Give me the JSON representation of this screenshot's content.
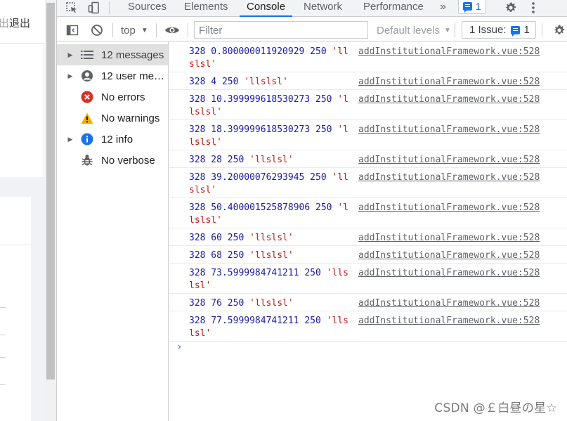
{
  "page": {
    "logout_text": "退出",
    "logout_partial_text": "出"
  },
  "devtools": {
    "tabs": [
      {
        "label": "Sources"
      },
      {
        "label": "Elements"
      },
      {
        "label": "Console"
      },
      {
        "label": "Network"
      },
      {
        "label": "Performance"
      }
    ],
    "more_tabs": "»",
    "issues_count": "1",
    "toolbar": {
      "context": "top",
      "filter_placeholder": "Filter",
      "levels_label": "Default levels",
      "issue_label": "1 Issue:",
      "issue_count": "1"
    },
    "sidebar": [
      {
        "label": "12 messages",
        "icon": "list-icon",
        "arrow": true
      },
      {
        "label": "12 user mes...",
        "icon": "user-icon",
        "arrow": true
      },
      {
        "label": "No errors",
        "icon": "error-icon",
        "arrow": false
      },
      {
        "label": "No warnings",
        "icon": "warning-icon",
        "arrow": false
      },
      {
        "label": "12 info",
        "icon": "info-icon",
        "arrow": true
      },
      {
        "label": "No verbose",
        "icon": "bug-icon",
        "arrow": false
      }
    ],
    "logs": [
      {
        "num_part": "328 0.800000011920929 250 ",
        "str_part": "'llslsl'",
        "source": "addInstitutionalFramework.vue:528"
      },
      {
        "num_part": "328 4 250 ",
        "str_part": "'llslsl'",
        "source": "addInstitutionalFramework.vue:528"
      },
      {
        "num_part": "328 10.399999618530273 250 ",
        "str_part": "'llslsl'",
        "source": "addInstitutionalFramework.vue:528"
      },
      {
        "num_part": "328 18.399999618530273 250 ",
        "str_part": "'llslsl'",
        "source": "addInstitutionalFramework.vue:528"
      },
      {
        "num_part": "328 28 250 ",
        "str_part": "'llslsl'",
        "source": "addInstitutionalFramework.vue:528"
      },
      {
        "num_part": "328 39.20000076293945 250 ",
        "str_part": "'llslsl'",
        "source": "addInstitutionalFramework.vue:528"
      },
      {
        "num_part": "328 50.400001525878906 250 ",
        "str_part": "'llslsl'",
        "source": "addInstitutionalFramework.vue:528"
      },
      {
        "num_part": "328 60 250 ",
        "str_part": "'llslsl'",
        "source": "addInstitutionalFramework.vue:528"
      },
      {
        "num_part": "328 68 250 ",
        "str_part": "'llslsl'",
        "source": "addInstitutionalFramework.vue:528"
      },
      {
        "num_part": "328 73.5999984741211 250 ",
        "str_part": "'llslsl'",
        "source": "addInstitutionalFramework.vue:528"
      },
      {
        "num_part": "328 76 250 ",
        "str_part": "'llslsl'",
        "source": "addInstitutionalFramework.vue:528"
      },
      {
        "num_part": "328 77.5999984741211 250 ",
        "str_part": "'llslsl'",
        "source": "addInstitutionalFramework.vue:528"
      }
    ],
    "prompt_symbol": "›"
  },
  "watermark": "CSDN @￡白昼の星☆",
  "colors": {
    "accent": "#1a73e8",
    "number_text": "#1a1aa6",
    "string_text": "#c41a16",
    "error": "#d93025",
    "warning": "#f9ab00"
  }
}
